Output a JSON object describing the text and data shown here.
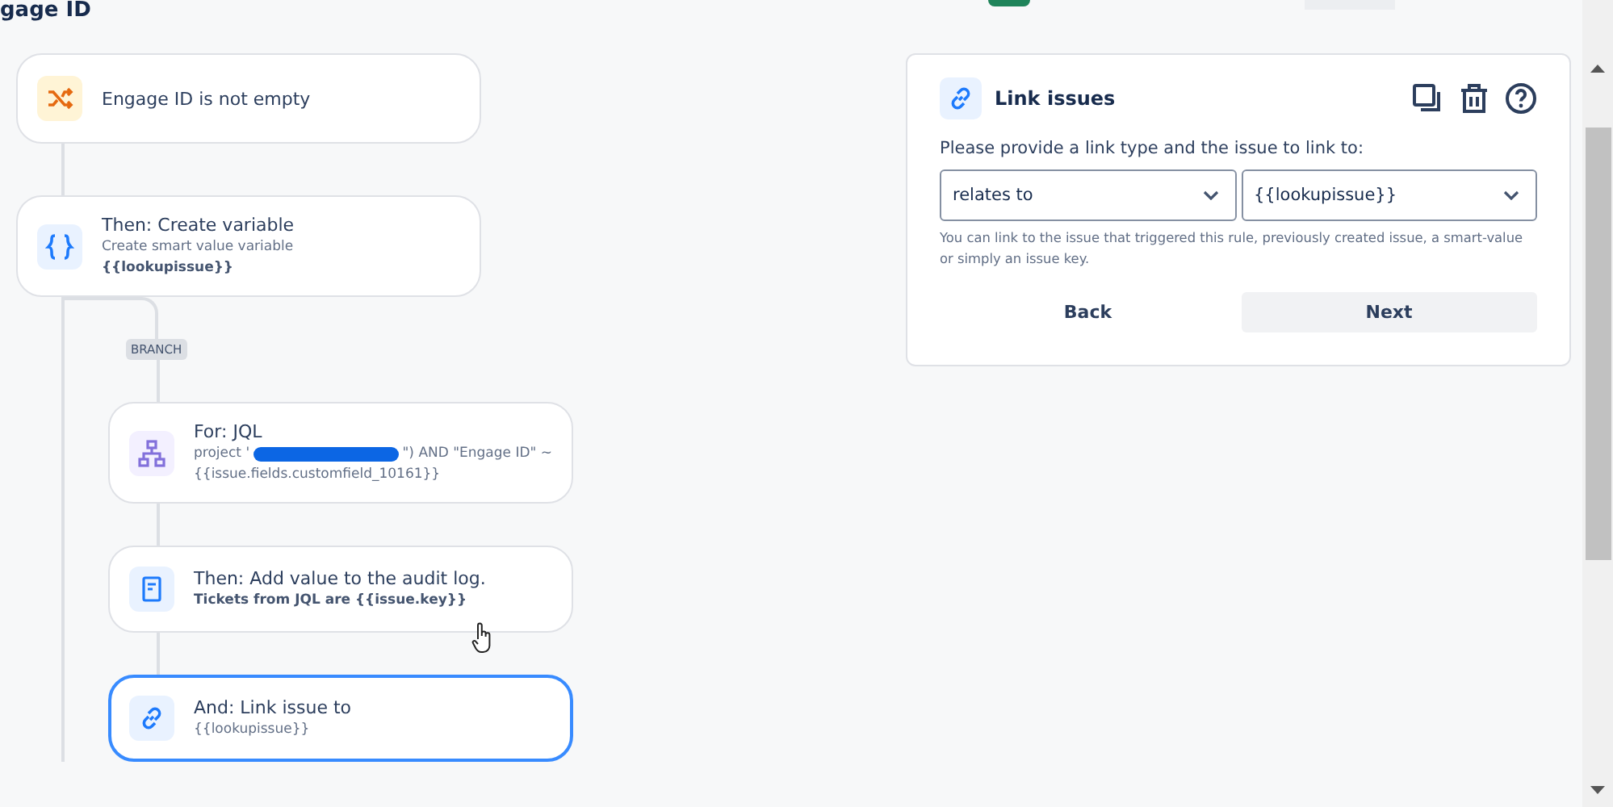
{
  "page": {
    "title": "gage ID"
  },
  "flow": [
    {
      "kind": "condition",
      "title": "Engage ID is not empty",
      "selected": false
    },
    {
      "kind": "variable",
      "title": "Then: Create variable",
      "subtitle": "Create smart value variable",
      "detail": "{{lookupissue}}",
      "selected": false
    }
  ],
  "branch": {
    "label": "BRANCH",
    "nodes": [
      {
        "kind": "loop",
        "title": "For: JQL",
        "query_start": "project '",
        "query_end": "\") AND \"Engage ID\" ~",
        "detail": "{{issue.fields.customfield_10161}}",
        "selected": false
      },
      {
        "kind": "log",
        "title": "Then: Add value to the audit log.",
        "detail": "Tickets from JQL are {{issue.key}}",
        "selected": false
      },
      {
        "kind": "link",
        "title": "And: Link issue to",
        "subtitle": "{{lookupissue}}",
        "selected": true
      }
    ]
  },
  "panel": {
    "title": "Link issues",
    "prompt": "Please provide a link type and the issue to link to:",
    "link_type": "relates to",
    "issue": "{{lookupissue}}",
    "help": "You can link to the issue that triggered this rule, previously created issue, a smart-value or simply an issue key.",
    "buttons": [
      {
        "label": "Back",
        "kind": "subtle"
      },
      {
        "label": "Next",
        "kind": "default"
      }
    ]
  }
}
